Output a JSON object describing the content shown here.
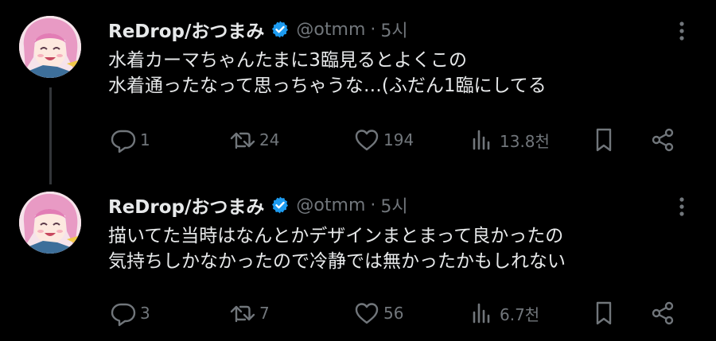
{
  "colors": {
    "background": "#000000",
    "text": "#e7e9ea",
    "muted": "#71767b",
    "verified": "#1d9bf0",
    "thread_line": "#333639"
  },
  "tweets": [
    {
      "author_name": "ReDrop/おつまみ",
      "handle": "@otmm",
      "separator": "·",
      "time": "5시",
      "text_lines": [
        "水着カーマちゃんたまに3臨見るとよくこの",
        "水着通ったなって思っちゃうな…(ふだん1臨にしてる"
      ],
      "replies": "1",
      "retweets": "24",
      "likes": "194",
      "views": "13.8천"
    },
    {
      "author_name": "ReDrop/おつまみ",
      "handle": "@otmm",
      "separator": "·",
      "time": "5시",
      "text_lines": [
        "描いてた当時はなんとかデザインまとまって良かったの",
        "気持ちしかなかったので冷静では無かったかもしれない"
      ],
      "replies": "3",
      "retweets": "7",
      "likes": "56",
      "views": "6.7천"
    }
  ],
  "icons": [
    "avatar-image",
    "verified-badge-icon",
    "more-options-icon",
    "reply-icon",
    "retweet-icon",
    "like-icon",
    "views-icon",
    "bookmark-icon",
    "share-icon"
  ]
}
